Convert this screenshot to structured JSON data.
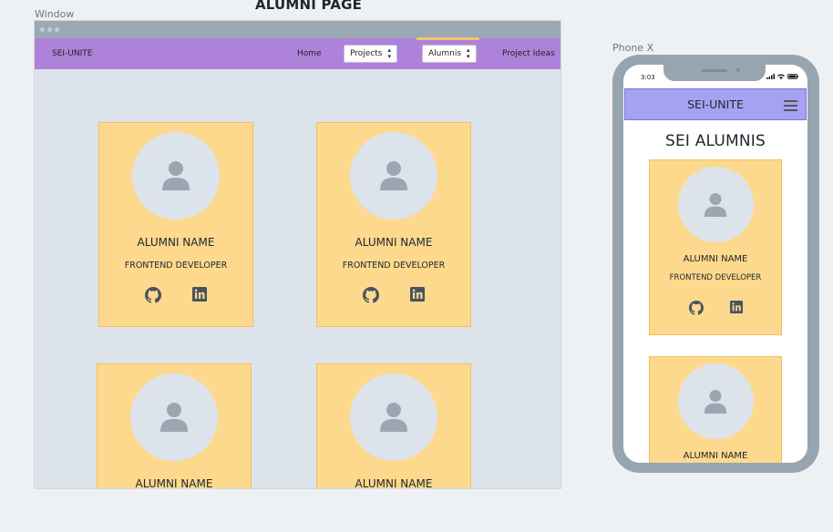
{
  "labels": {
    "window": "Window",
    "phone": "Phone X",
    "page_title": "ALUMNI PAGE"
  },
  "desktop": {
    "brand": "SEI-UNITE",
    "nav": {
      "home": "Home",
      "projects": "Projects",
      "alumnis": "Alumnis",
      "project_ideas": "Project Ideas"
    },
    "cards": [
      {
        "name": "ALUMNI NAME",
        "role": "FRONTEND DEVELOPER"
      },
      {
        "name": "ALUMNI NAME",
        "role": "FRONTEND DEVELOPER"
      },
      {
        "name": "ALUMNI NAME"
      },
      {
        "name": "ALUMNI NAME"
      }
    ]
  },
  "phone": {
    "time": "3:03",
    "brand": "SEI-UNITE",
    "heading": "SEI ALUMNIS",
    "cards": [
      {
        "name": "ALUMNI NAME",
        "role": "FRONTEND DEVELOPER"
      },
      {
        "name": "ALUMNI NAME"
      }
    ]
  },
  "icons": {
    "avatar": "user-icon",
    "social": [
      "github-icon",
      "linkedin-icon"
    ],
    "menu": "hamburger-menu-icon"
  },
  "colors": {
    "navbar": "#ae82d9",
    "phone_navbar": "#a6a2f2",
    "card": "#fcd98c",
    "card_border": "#f0c060",
    "canvas": "#dde3ea",
    "active_indicator": "#f2c46a",
    "icon": "#4a5260"
  }
}
